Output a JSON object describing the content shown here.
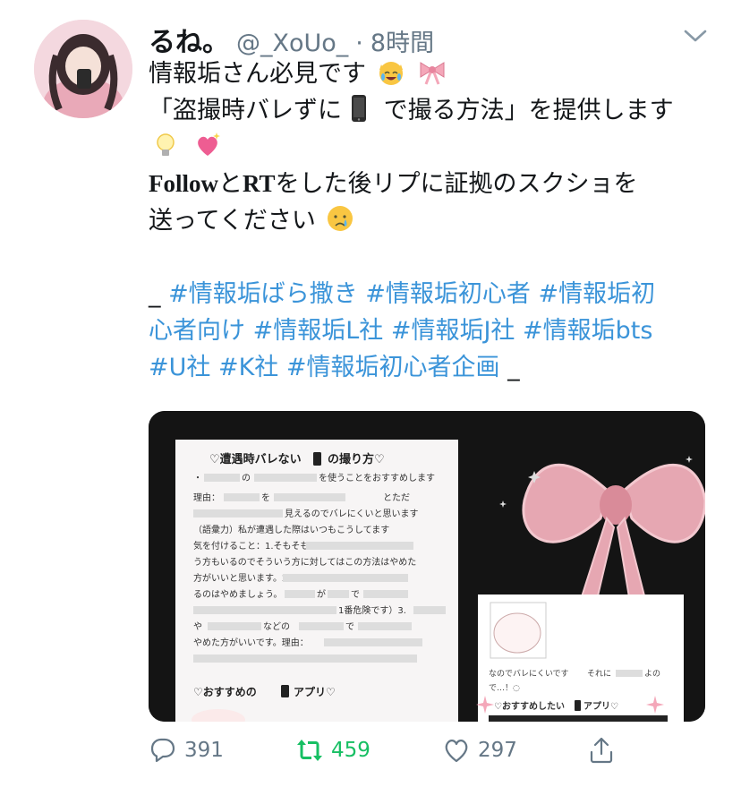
{
  "tweet": {
    "display_name": "るね。",
    "handle": "@_XoUo_",
    "separator": "·",
    "time": "8時間",
    "text_lines": [
      "情報垢さん必見です",
      "「盗撮時バレずに",
      " で撮る方法」を提供します",
      "と",
      "をした後リプに証拠のスクショを",
      "送ってください"
    ],
    "follow_word": "Follow",
    "rt_word": "RT",
    "hashtag_prefix": "_ ",
    "hashtag_lines": [
      "#情報垢ばら撒き #情報垢初心者 #情報垢初",
      "心者向け #情報垢L社 #情報垢J社 #情報垢bts",
      "#U社 #K社 #情報垢初心者企画"
    ],
    "hashtag_suffix": "  _"
  },
  "media": {
    "doc_title": "♡遭遇時バレない",
    "doc_title_tail": "の撮り方♡",
    "doc_lines": [
      "・",
      "の",
      "を使うことをおすすめします",
      "理由：",
      "を",
      "とただ",
      "見えるのでバレにくいと思います",
      "（語彙力）私が遭遇した際はいつもこうしてます",
      "気を付けること：1.そもそも",
      "う方もいるのでそういう方に対してはこの方法はやめた",
      "方がいいと思います。2.",
      "るのはやめましょう。",
      "が",
      "で",
      "1番危険です）3.",
      "や",
      "などの",
      "で",
      "やめた方がいいです。理由：",
      "♡おすすめの",
      "アプリ♡"
    ],
    "small_card_lines": [
      "なのでバレにくいです",
      "それに",
      "よの",
      "で…！◌",
      "♡おすすめしたい",
      "アプリ♡"
    ]
  },
  "actions": {
    "reply_count": "391",
    "retweet_count": "459",
    "like_count": "297"
  },
  "colors": {
    "link": "#3b94d9",
    "secondary": "#657786",
    "retweet": "#17bf63"
  },
  "icons": [
    "caret-down-icon",
    "reply-icon",
    "retweet-icon",
    "like-icon",
    "share-icon"
  ]
}
